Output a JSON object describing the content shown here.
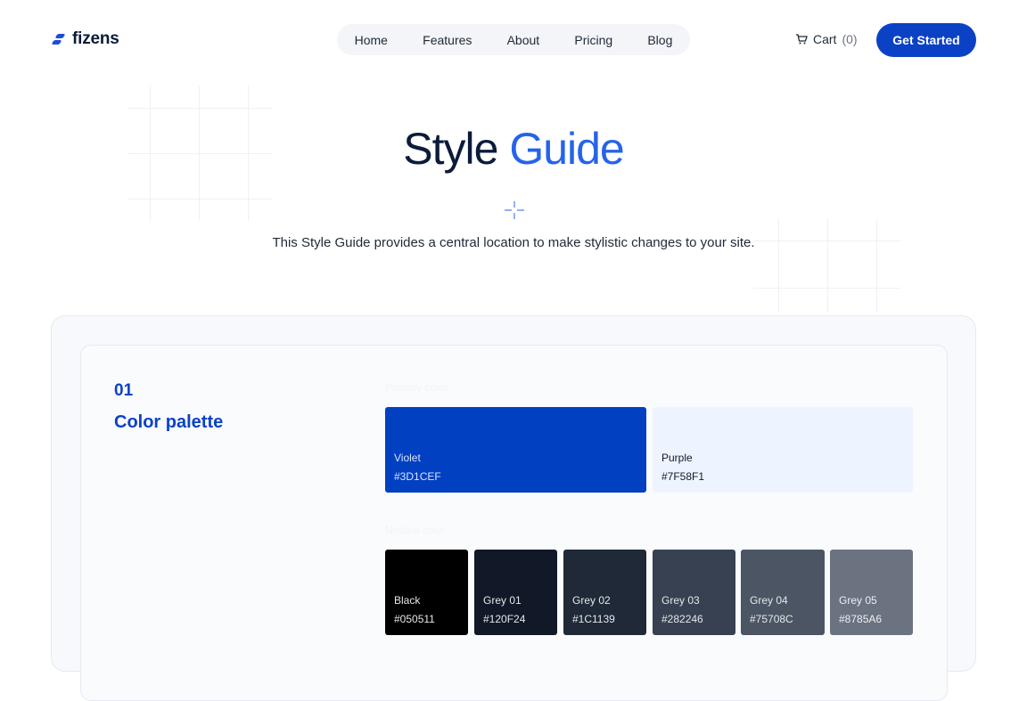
{
  "header": {
    "logo_text": "fizens",
    "nav": [
      "Home",
      "Features",
      "About",
      "Pricing",
      "Blog"
    ],
    "cart_label": "Cart",
    "cart_count": "(0)",
    "cta_label": "Get Started"
  },
  "hero": {
    "title_main": "Style",
    "title_accent": "Guide",
    "subtitle": "This Style Guide provides a central location to make stylistic changes to your site."
  },
  "section": {
    "number": "01",
    "title": "Color palette"
  },
  "primary": {
    "label": "Primary color",
    "swatches": [
      {
        "name": "Violet",
        "hex": "#3D1CEF",
        "display_color": "#0040C1"
      },
      {
        "name": "Purple",
        "hex": "#7F58F1",
        "display_color": "#EEF4FF"
      }
    ]
  },
  "neutral": {
    "label": "Neutral color",
    "swatches": [
      {
        "name": "Black",
        "hex": "#050511",
        "display_color": "#000000"
      },
      {
        "name": "Grey 01",
        "hex": "#120F24",
        "display_color": "#111827"
      },
      {
        "name": "Grey 02",
        "hex": "#1C1139",
        "display_color": "#1F2937"
      },
      {
        "name": "Grey 03",
        "hex": "#282246",
        "display_color": "#374151"
      },
      {
        "name": "Grey 04",
        "hex": "#75708C",
        "display_color": "#4B5563"
      },
      {
        "name": "Grey 05",
        "hex": "#8785A6",
        "display_color": "#6B7280"
      }
    ]
  },
  "colors": {
    "accent": "#2563EB",
    "button": "#0B42C5"
  }
}
